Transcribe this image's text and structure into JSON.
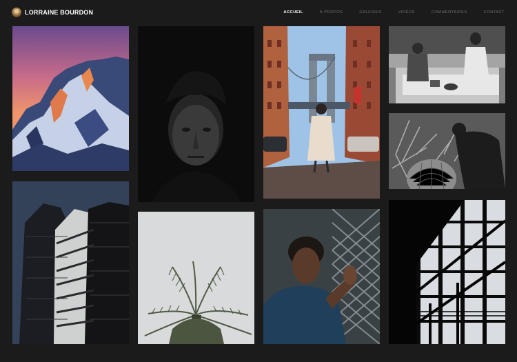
{
  "site": {
    "name": "LORRAINE BOURDON",
    "avatar": "photographer-portrait-avatar"
  },
  "nav": {
    "items": [
      "ACCUEIL",
      "À PROPOS",
      "GALERIES",
      "VIDÉOS",
      "COMMENTAIRES",
      "CONTACT"
    ],
    "active": "ACCUEIL"
  },
  "gallery": {
    "photos": [
      "snowy-mountain-sunset-photo",
      "dark-portrait-man-photo",
      "manhattan-bridge-street-photo",
      "kitchen-couple-bw-photo",
      "cactus-garden-bw-photo",
      "modern-building-curves-photo",
      "palm-tree-sky-photo",
      "man-blue-jacket-fence-photo",
      "dark-staircase-window-photo"
    ]
  },
  "colors": {
    "background": "#1b1b1b",
    "nav_active": "#ffffff",
    "nav_inactive": "#6e6e6e"
  }
}
